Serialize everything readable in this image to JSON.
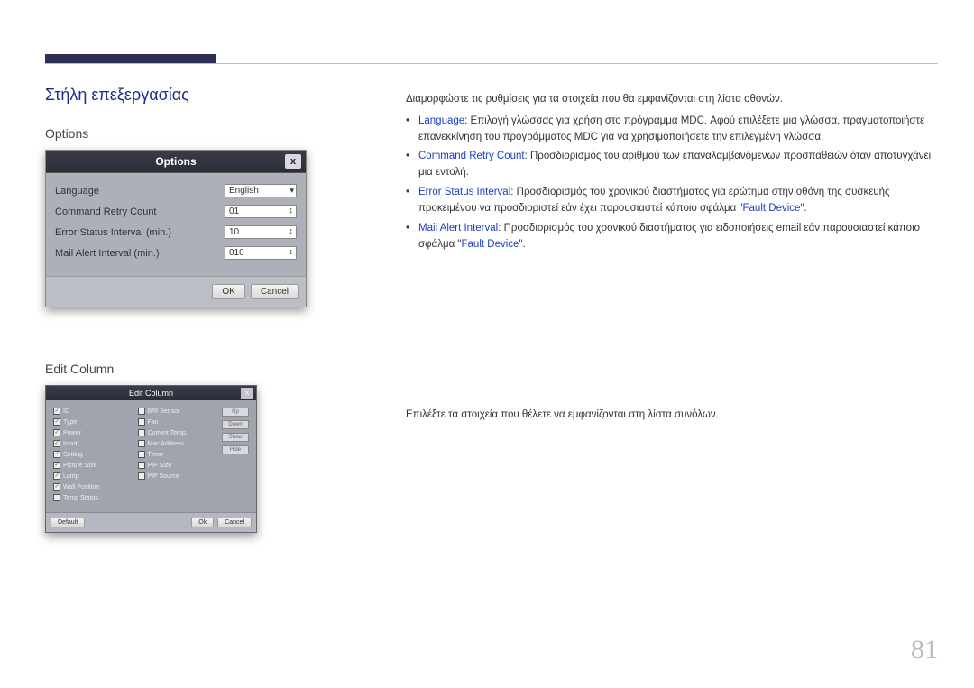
{
  "section_title": "Στήλη επεξεργασίας",
  "options": {
    "heading": "Options",
    "dialog_title": "Options",
    "close": "x",
    "rows": {
      "language_label": "Language",
      "language_value": "English",
      "retry_label": "Command Retry Count",
      "retry_value": "01",
      "error_label": "Error Status Interval (min.)",
      "error_value": "10",
      "mail_label": "Mail Alert Interval (min.)",
      "mail_value": "010"
    },
    "ok": "OK",
    "cancel": "Cancel"
  },
  "edit": {
    "heading": "Edit Column",
    "dialog_title": "Edit Column",
    "close": "x",
    "col1": [
      {
        "label": "ID",
        "checked": true
      },
      {
        "label": "Type",
        "checked": true
      },
      {
        "label": "Power",
        "checked": true
      },
      {
        "label": "Input",
        "checked": true
      },
      {
        "label": "Setting",
        "checked": true
      },
      {
        "label": "Picture Size",
        "checked": true
      },
      {
        "label": "Lamp",
        "checked": true
      },
      {
        "label": "Wall Position",
        "checked": true
      },
      {
        "label": "Temp Status",
        "checked": false
      }
    ],
    "col2": [
      {
        "label": "B/R Sensor",
        "checked": false
      },
      {
        "label": "Fan",
        "checked": false
      },
      {
        "label": "Current Temp.",
        "checked": false
      },
      {
        "label": "Mac Address",
        "checked": false
      },
      {
        "label": "Timer",
        "checked": false
      },
      {
        "label": "PIP Size",
        "checked": false
      },
      {
        "label": "PIP Source",
        "checked": false
      }
    ],
    "side": [
      "Up",
      "Down",
      "Show",
      "Hide"
    ],
    "default": "Default",
    "ok": "Ok",
    "cancel": "Cancel"
  },
  "right": {
    "intro": "Διαμορφώστε τις ρυθμίσεις για τα στοιχεία που θα εμφανίζονται στη λίστα οθονών.",
    "b1_key": "Language",
    "b1_txt": ": Επιλογή γλώσσας για χρήση στο πρόγραμμα MDC. Αφού επιλέξετε μια γλώσσα, πραγματοποιήστε επανεκκίνηση του προγράμματος MDC για να χρησιμοποιήσετε την επιλεγμένη γλώσσα.",
    "b2_key": "Command Retry Count",
    "b2_txt": ": Προσδιορισμός του αριθμού των επαναλαμβανόμενων προσπαθειών όταν αποτυγχάνει μια εντολή.",
    "b3_key": "Error Status Interval",
    "b3_txt_a": ": Προσδιορισμός του χρονικού διαστήματος για ερώτημα στην οθόνη της συσκευής προκειμένου να προσδιοριστεί εάν έχει παρουσιαστεί κάποιο σφάλμα \"",
    "b3_fault": "Fault Device",
    "b3_txt_b": "\".",
    "b4_key": "Mail Alert Interval",
    "b4_txt_a": ": Προσδιορισμός του χρονικού διαστήματος για ειδοποιήσεις email εάν παρουσιαστεί κάποιο σφάλμα \"",
    "b4_fault": "Fault Device",
    "b4_txt_b": "\"."
  },
  "right2": "Επιλέξτε τα στοιχεία που θέλετε να εμφανίζονται στη λίστα συνόλων.",
  "page": "81"
}
